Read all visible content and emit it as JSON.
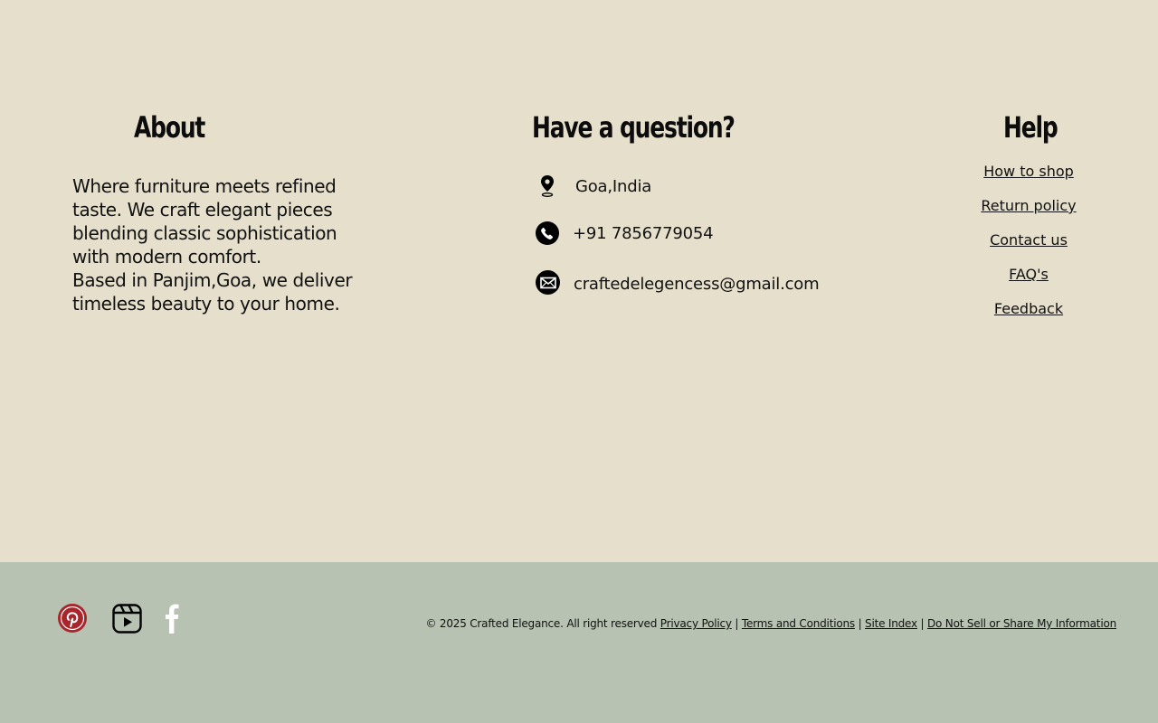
{
  "about": {
    "heading": "About",
    "paragraph1": "Where furniture meets refined taste. We craft elegant pieces blending classic sophistication with modern comfort.",
    "paragraph2": "Based in Panjim,Goa, we deliver timeless beauty to your home."
  },
  "contact": {
    "heading": "Have a question?",
    "location": "Goa,India",
    "phone": "+91 7856779054",
    "email": "craftedelegencess@gmail.com"
  },
  "help": {
    "heading": "Help",
    "links": [
      "How to shop",
      "Return policy",
      "Contact us",
      "FAQ's",
      "Feedback"
    ]
  },
  "footer": {
    "copyright": "© 2025 Crafted Elegance. All right reserved",
    "links": [
      "Privacy Policy",
      "Terms and Conditions",
      "Site Index",
      "Do Not Sell or Share My Information"
    ],
    "separator": "|",
    "social_icons": [
      "pinterest-icon",
      "reels-icon",
      "facebook-icon"
    ]
  },
  "colors": {
    "upper_background": "#e5dfcb",
    "footer_background": "#b7c2b2",
    "pinterest": "#a8252b"
  }
}
